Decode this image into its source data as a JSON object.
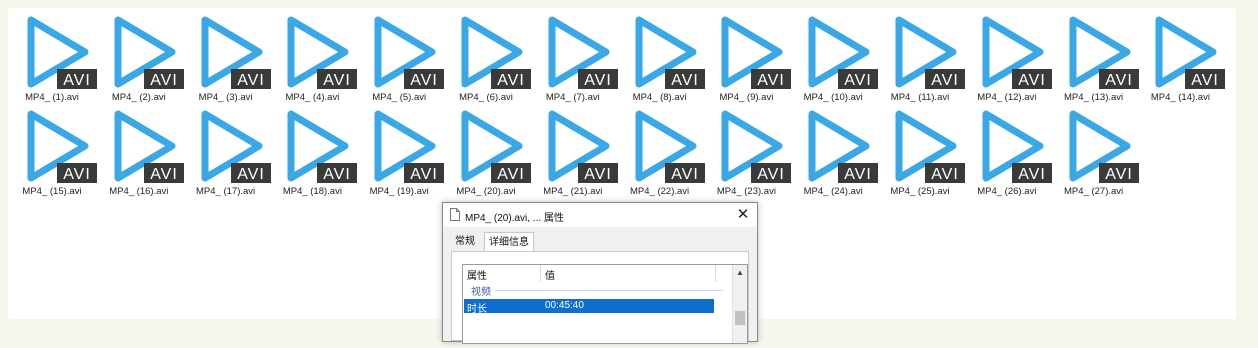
{
  "files": [
    {
      "name": "MP4_ (1).avi"
    },
    {
      "name": "MP4_ (2).avi"
    },
    {
      "name": "MP4_ (3).avi"
    },
    {
      "name": "MP4_ (4).avi"
    },
    {
      "name": "MP4_ (5).avi"
    },
    {
      "name": "MP4_ (6).avi"
    },
    {
      "name": "MP4_ (7).avi"
    },
    {
      "name": "MP4_ (8).avi"
    },
    {
      "name": "MP4_ (9).avi"
    },
    {
      "name": "MP4_ (10).avi"
    },
    {
      "name": "MP4_ (11).avi"
    },
    {
      "name": "MP4_ (12).avi"
    },
    {
      "name": "MP4_ (13).avi"
    },
    {
      "name": "MP4_ (14).avi"
    },
    {
      "name": "MP4_ (15).avi"
    },
    {
      "name": "MP4_ (16).avi"
    },
    {
      "name": "MP4_ (17).avi"
    },
    {
      "name": "MP4_ (18).avi"
    },
    {
      "name": "MP4_ (19).avi"
    },
    {
      "name": "MP4_ (20).avi"
    },
    {
      "name": "MP4_ (21).avi"
    },
    {
      "name": "MP4_ (22).avi"
    },
    {
      "name": "MP4_ (23).avi"
    },
    {
      "name": "MP4_ (24).avi"
    },
    {
      "name": "MP4_ (25).avi"
    },
    {
      "name": "MP4_ (26).avi"
    },
    {
      "name": "MP4_ (27).avi"
    }
  ],
  "file_icon": {
    "name": "avi-play-icon",
    "badge": "AVI",
    "play_color": "#3aa7e6",
    "badge_color": "#3a3a3a"
  },
  "dialog": {
    "title": "MP4_ (20).avi, ... 属性",
    "close": "✕",
    "tabs": {
      "general": "常规",
      "details": "详细信息"
    },
    "columns": {
      "property": "属性",
      "value": "值"
    },
    "group": "视频",
    "selected_row": {
      "key": "时长",
      "value": "00:45:40"
    }
  },
  "colors": {
    "selection": "#0f6fcf",
    "background": "#f7f6ec"
  }
}
